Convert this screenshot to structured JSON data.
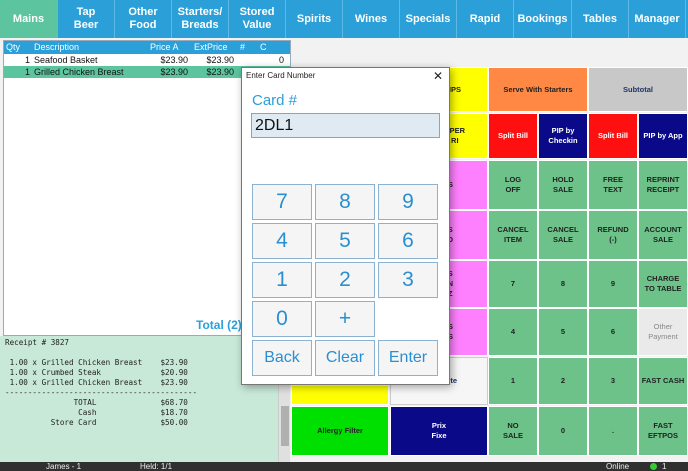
{
  "tabs": [
    {
      "label": "Mains",
      "active": true
    },
    {
      "label": "Tap\nBeer"
    },
    {
      "label": "Other\nFood"
    },
    {
      "label": "Starters/\nBreads"
    },
    {
      "label": "Stored\nValue"
    },
    {
      "label": "Spirits"
    },
    {
      "label": "Wines"
    },
    {
      "label": "Specials"
    },
    {
      "label": "Rapid"
    },
    {
      "label": "Bookings"
    },
    {
      "label": "Tables"
    },
    {
      "label": "Manager"
    }
  ],
  "order": {
    "headers": [
      "Qty",
      "Description",
      "Price A",
      "ExtPrice",
      "#",
      "C"
    ],
    "rows": [
      [
        "1",
        "Seafood Basket",
        "$23.90",
        "$23.90",
        "",
        "0"
      ],
      [
        "1",
        "Grilled Chicken Breast",
        "$23.90",
        "$23.90",
        "",
        "0"
      ]
    ],
    "total_label": "Total (2)"
  },
  "receipt": {
    "text": "Receipt # 3827\n\n 1.00 x Grilled Chicken Breast    $23.90\n 1.00 x Crumbed Steak             $20.90\n 1.00 x Grilled Chicken Breast    $23.90\n------------------------------------------\n               TOTAL              $68.70\n                Cash              $18.70\n          Store Card              $50.00"
  },
  "grid": {
    "row1": [
      "IPS",
      "Serve With Starters",
      "Subtotal"
    ],
    "row2": [
      "PPER\nRI",
      "Split Bill",
      "PIP by\nCheckin",
      "Split Bill",
      "PIP by App"
    ],
    "row3": [
      "S",
      "LOG\nOFF",
      "HOLD\nSALE",
      "FREE\nTEXT",
      "REPRINT\nRECEIPT"
    ],
    "row4": [
      "S\nD",
      "CANCEL\nITEM",
      "CANCEL\nSALE",
      "REFUND\n(-)",
      "ACCOUNT\nSALE"
    ],
    "row5": [
      "S\nN\nZ",
      "7",
      "8",
      "9",
      "CHARGE\nTO TABLE"
    ],
    "row6": [
      "S\nS",
      "4",
      "5",
      "6",
      "Other\nPayment"
    ],
    "row7": [
      "te",
      "1",
      "2",
      "3",
      "FAST CASH"
    ],
    "row8": [
      "Allergy Filter",
      "Prix\nFixe",
      "NO\nSALE",
      "0",
      ".",
      "FAST EFTPOS"
    ]
  },
  "dialog": {
    "title": "Enter Card Number",
    "label": "Card #",
    "value": "2DL1",
    "keys": [
      "7",
      "8",
      "9",
      "4",
      "5",
      "6",
      "1",
      "2",
      "3",
      "0",
      "+",
      "Back",
      "Clear",
      "Enter"
    ]
  },
  "status": {
    "user": "James - 1",
    "held": "Held: 1/1",
    "online": "Online",
    "count": "1"
  },
  "colors": {
    "accent": "#2a9fd8",
    "selected_row": "#5dc4a0",
    "receipt_bg": "#c8e8d8"
  }
}
